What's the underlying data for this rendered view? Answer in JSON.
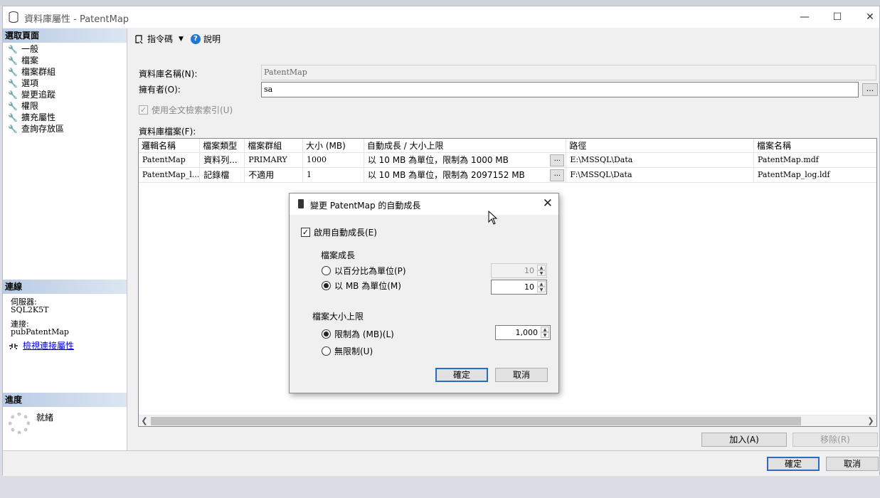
{
  "window": {
    "title": "資料庫屬性 - PatentMap"
  },
  "sidebar": {
    "select_page_header": "選取頁面",
    "items": [
      {
        "label": "一般"
      },
      {
        "label": "檔案"
      },
      {
        "label": "檔案群組"
      },
      {
        "label": "選項"
      },
      {
        "label": "變更追蹤"
      },
      {
        "label": "權限"
      },
      {
        "label": "擴充屬性"
      },
      {
        "label": "查詢存放區"
      }
    ],
    "connection_header": "連線",
    "server_label": "伺服器:",
    "server_value": "SQL2K5T",
    "connection_label": "連接:",
    "connection_value": "pubPatentMap",
    "view_props_link": "檢視連接屬性",
    "progress_header": "進度",
    "status": "就緒"
  },
  "toolbar": {
    "script_label": "指令碼",
    "help_label": "說明"
  },
  "form": {
    "db_name_label": "資料庫名稱(N):",
    "db_name_value": "PatentMap",
    "owner_label": "擁有者(O):",
    "owner_value": "sa",
    "owner_browse": "...",
    "fulltext_label": "使用全文檢索索引(U)",
    "files_label": "資料庫檔案(F):"
  },
  "files_table": {
    "columns": [
      "邏輯名稱",
      "檔案類型",
      "檔案群組",
      "大小 (MB)",
      "自動成長 / 大小上限",
      "路徑",
      "檔案名稱"
    ],
    "rows": [
      [
        "PatentMap",
        "資料列...",
        "PRIMARY",
        "1000",
        "以 10 MB 為單位，限制為 1000 MB",
        "E:\\MSSQL\\Data",
        "PatentMap.mdf"
      ],
      [
        "PatentMap_l...",
        "記錄檔",
        "不適用",
        "1",
        "以 10 MB 為單位，限制為 2097152 MB",
        "F:\\MSSQL\\Data",
        "PatentMap_log.ldf"
      ]
    ],
    "cell_button": "..."
  },
  "buttons": {
    "add": "加入(A)",
    "remove": "移除(R)",
    "ok": "確定",
    "cancel": "取消"
  },
  "dialog": {
    "title": "變更 PatentMap 的自動成長",
    "enable_autogrowth": "啟用自動成長(E)",
    "file_growth_header": "檔案成長",
    "percent_label": "以百分比為單位(P)",
    "percent_value": "10",
    "mb_label": "以 MB 為單位(M)",
    "mb_value": "10",
    "max_size_header": "檔案大小上限",
    "limited_label": "限制為 (MB)(L)",
    "limited_value": "1,000",
    "unlimited_label": "無限制(U)",
    "ok": "確定",
    "cancel": "取消"
  }
}
